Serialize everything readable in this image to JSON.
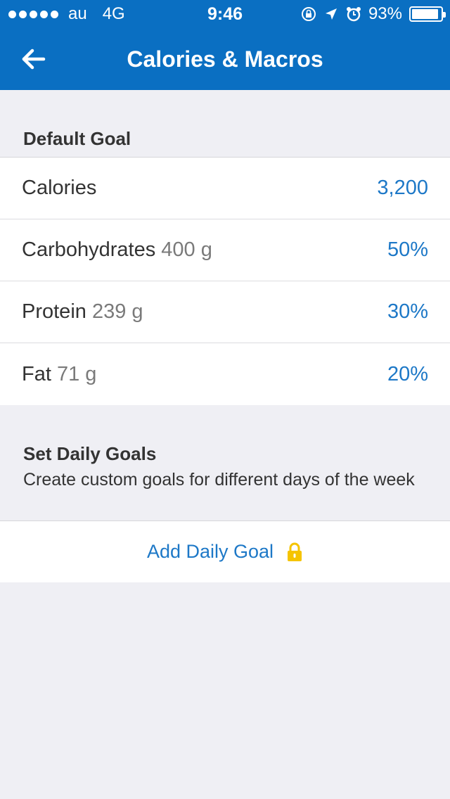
{
  "status_bar": {
    "carrier": "au",
    "network": "4G",
    "time": "9:46",
    "battery": "93%"
  },
  "nav": {
    "title": "Calories & Macros",
    "back_icon": "arrow-left-icon"
  },
  "default_goal": {
    "header": "Default Goal",
    "rows": [
      {
        "label": "Calories",
        "sub": "",
        "value": "3,200"
      },
      {
        "label": "Carbohydrates",
        "sub": "400 g",
        "value": "50%"
      },
      {
        "label": "Protein",
        "sub": "239 g",
        "value": "30%"
      },
      {
        "label": "Fat",
        "sub": "71 g",
        "value": "20%"
      }
    ]
  },
  "daily_goals": {
    "header": "Set Daily Goals",
    "description": "Create custom goals for different days of the week",
    "add_label": "Add Daily Goal",
    "lock_icon": "lock-icon"
  },
  "colors": {
    "bar": "#0a6fc2",
    "accent": "#1d78c7",
    "lock": "#f5c400",
    "background": "#efeff4"
  }
}
